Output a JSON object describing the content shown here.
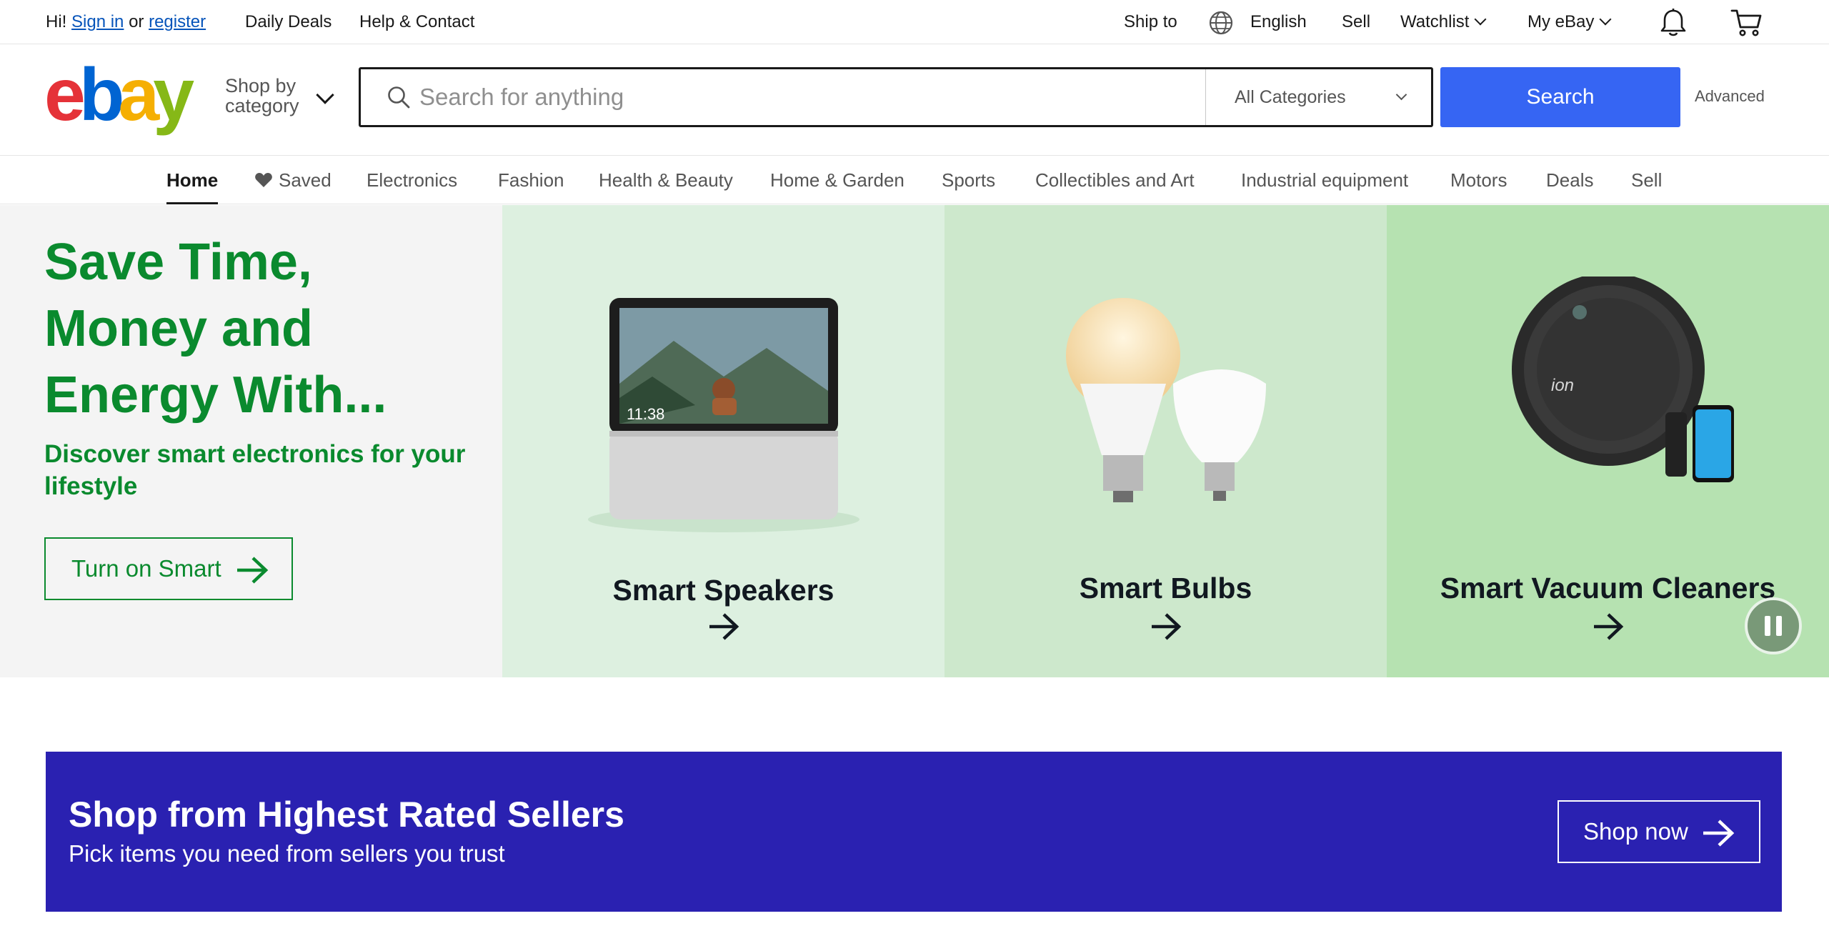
{
  "topbar": {
    "greeting": "Hi!",
    "sign_in": "Sign in",
    "or": "or",
    "register": "register",
    "daily_deals": "Daily Deals",
    "help_contact": "Help & Contact",
    "ship_to": "Ship to",
    "language": "English",
    "sell": "Sell",
    "watchlist": "Watchlist",
    "my_ebay": "My eBay"
  },
  "header": {
    "shop_by_line1": "Shop by",
    "shop_by_line2": "category",
    "search_placeholder": "Search for anything",
    "search_value": "",
    "category_selected": "All Categories",
    "search_button": "Search",
    "advanced": "Advanced"
  },
  "nav": {
    "items": [
      "Home",
      "Saved",
      "Electronics",
      "Fashion",
      "Health & Beauty",
      "Home & Garden",
      "Sports",
      "Collectibles and Art",
      "Industrial equipment",
      "Motors",
      "Deals",
      "Sell"
    ],
    "active": "Home"
  },
  "hero": {
    "title": "Save Time, Money and Energy With...",
    "subtitle": "Discover smart electronics for your lifestyle",
    "cta": "Turn on Smart",
    "tiles": [
      {
        "label": "Smart Speakers",
        "bg": "#ddf0e0",
        "clock": "11:38"
      },
      {
        "label": "Smart Bulbs",
        "bg": "#cde8cc"
      },
      {
        "label": "Smart Vacuum Cleaners",
        "bg": "#b6e2b1",
        "brand": "ion"
      }
    ]
  },
  "promo": {
    "title": "Shop from Highest Rated Sellers",
    "subtitle": "Pick items you need from sellers you trust",
    "button": "Shop now"
  },
  "colors": {
    "brand_blue": "#3665f3",
    "hero_green": "#0a8a2e",
    "promo_bg": "#2a21b1",
    "link_blue": "#0654ba"
  }
}
